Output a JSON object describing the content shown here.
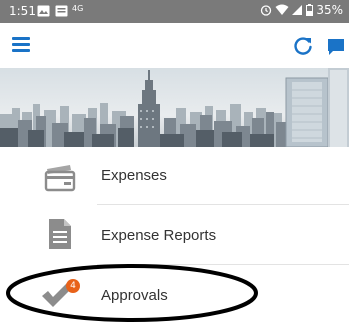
{
  "status_bar": {
    "time": "1:51",
    "signal_text": "4G",
    "battery": "35%",
    "icons": [
      "image-icon",
      "message-icon",
      "alarm-icon",
      "wifi-icon",
      "signal-icon",
      "battery-icon"
    ]
  },
  "app_bar": {
    "icons": [
      "menu-icon",
      "refresh-icon",
      "chat-icon"
    ],
    "accent": "#1a73c7"
  },
  "menu": {
    "items": [
      {
        "label": "Expenses",
        "icon": "card-icon"
      },
      {
        "label": "Expense Reports",
        "icon": "document-icon"
      },
      {
        "label": "Approvals",
        "icon": "checkmark-icon",
        "badge": "4"
      }
    ]
  },
  "colors": {
    "status_bar": "#7a7a7a",
    "badge": "#e8621a",
    "text": "#333333",
    "icon_gray": "#8c8c8c"
  }
}
